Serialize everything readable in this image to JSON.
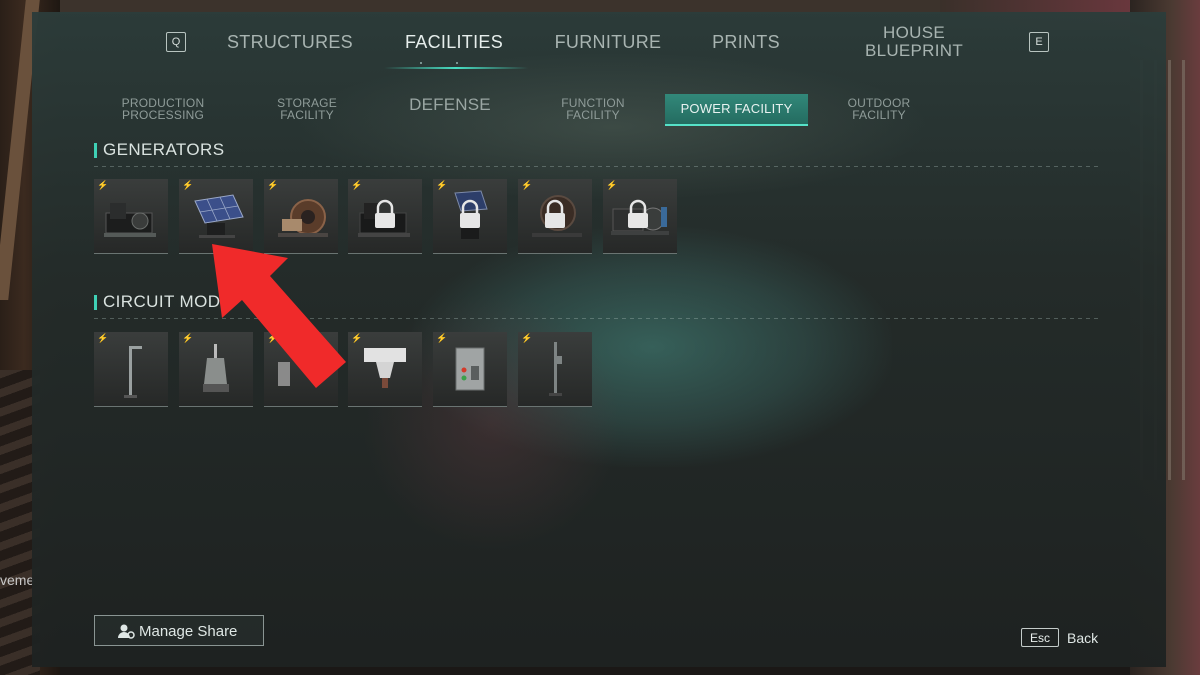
{
  "top_tabs": {
    "left_key": "Q",
    "right_key": "E",
    "items": [
      {
        "label": "STRUCTURES"
      },
      {
        "label": "FACILITIES",
        "active": true
      },
      {
        "label": "FURNITURE"
      },
      {
        "label": "PRINTS"
      },
      {
        "label_line1": "HOUSE",
        "label_line2": "BLUEPRINT"
      }
    ]
  },
  "sub_tabs": [
    {
      "line1": "PRODUCTION",
      "line2": "PROCESSING"
    },
    {
      "line1": "STORAGE",
      "line2": "FACILITY"
    },
    {
      "label": "DEFENSE"
    },
    {
      "line1": "FUNCTION",
      "line2": "FACILITY"
    },
    {
      "label": "POWER FACILITY",
      "active": true
    },
    {
      "line1": "OUTDOOR",
      "line2": "FACILITY"
    }
  ],
  "sections": {
    "generators": {
      "title": "GENERATORS",
      "items": [
        {
          "icon": "generator-engine-icon",
          "locked": false
        },
        {
          "icon": "solar-panel-icon",
          "locked": false,
          "highlighted": true
        },
        {
          "icon": "water-wheel-generator-icon",
          "locked": false
        },
        {
          "icon": "generator-engine-icon",
          "locked": true
        },
        {
          "icon": "solar-panel-icon",
          "locked": true
        },
        {
          "icon": "water-wheel-generator-icon",
          "locked": true
        },
        {
          "icon": "generator-motor-icon",
          "locked": true
        }
      ]
    },
    "circuit": {
      "title": "CIRCUIT MODU",
      "items": [
        {
          "icon": "street-lamp-icon"
        },
        {
          "icon": "transformer-icon"
        },
        {
          "icon": "insulator-icon"
        },
        {
          "icon": "ceramic-insulator-icon"
        },
        {
          "icon": "electrical-box-icon"
        },
        {
          "icon": "signal-pole-icon"
        }
      ]
    }
  },
  "bottom": {
    "manage_share": "Manage Share",
    "esc_key": "Esc",
    "back": "Back"
  },
  "edge_text": "veme",
  "colors": {
    "accent": "#48e0c4",
    "annotation_arrow": "#f02a2a"
  }
}
